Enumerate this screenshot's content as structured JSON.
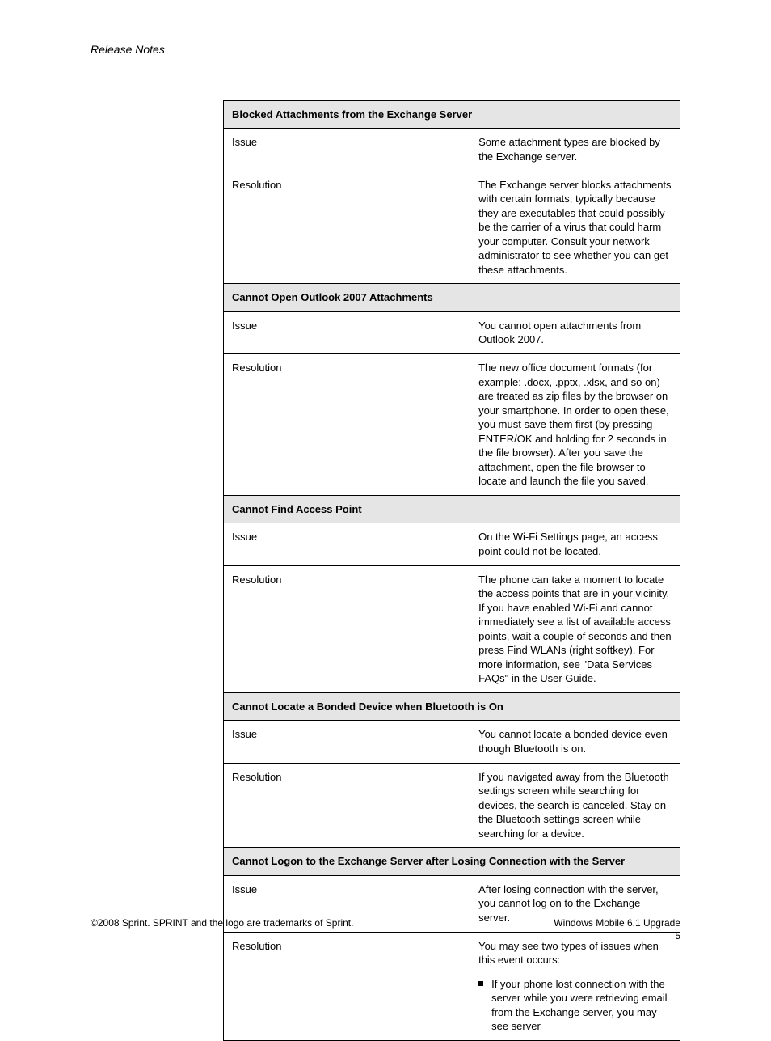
{
  "header": {
    "running_title": "Release Notes"
  },
  "sections": [
    {
      "title": "Blocked Attachments from the Exchange Server",
      "problem_label": "Issue",
      "problem_text": "Some attachment types are blocked by the Exchange server.",
      "resolution_label": "Resolution",
      "resolution_text": "The Exchange server blocks attachments with certain formats, typically because they are executables that could possibly be the carrier of a virus that could harm your computer. Consult your network administrator to see whether you can get these attachments."
    },
    {
      "title": "Cannot Open Outlook 2007 Attachments",
      "problem_label": "Issue",
      "problem_text": "You cannot open attachments from Outlook 2007.",
      "resolution_label": "Resolution",
      "resolution_text": "The new office document formats (for example: .docx, .pptx, .xlsx, and so on) are treated as zip files by the browser on your smartphone. In order to open these, you must save them first (by pressing ENTER/OK and holding for 2 seconds in the file browser). After you save the attachment, open the file browser to locate and launch the file you saved."
    },
    {
      "title": "Cannot Find Access Point",
      "problem_label": "Issue",
      "problem_text": "On the Wi-Fi Settings page, an access point could not be located.",
      "resolution_label": "Resolution",
      "resolution_text": "The phone can take a moment to locate the access points that are in your vicinity. If you have enabled Wi-Fi and cannot immediately see a list of available access points, wait a couple of seconds and then press Find WLANs (right softkey). For more information, see \"Data Services FAQs\" in the User Guide."
    },
    {
      "title": "Cannot Locate a Bonded Device when Bluetooth is On",
      "problem_label": "Issue",
      "problem_text": "You cannot locate a bonded device even though Bluetooth is on.",
      "resolution_label": "Resolution",
      "resolution_text": "If you navigated away from the Bluetooth settings screen while searching for devices, the search is canceled. Stay on the Bluetooth settings screen while searching for a device."
    },
    {
      "title": "Cannot Logon to the Exchange Server after Losing Connection with the Server",
      "problem_label": "Issue",
      "problem_text": "After losing connection with the server, you cannot log on to the Exchange server.",
      "resolution_label": "Resolution",
      "resolution_text": "You may see two types of issues when this event occurs:",
      "bullets": [
        "If your phone lost connection with the server while you were retrieving email from the Exchange server, you may see server"
      ]
    }
  ],
  "footer": {
    "left": "©2008 Sprint. SPRINT and the logo are trademarks of Sprint.",
    "right_line1": "Windows Mobile 6.1 Upgrade",
    "right_line2": "5"
  }
}
